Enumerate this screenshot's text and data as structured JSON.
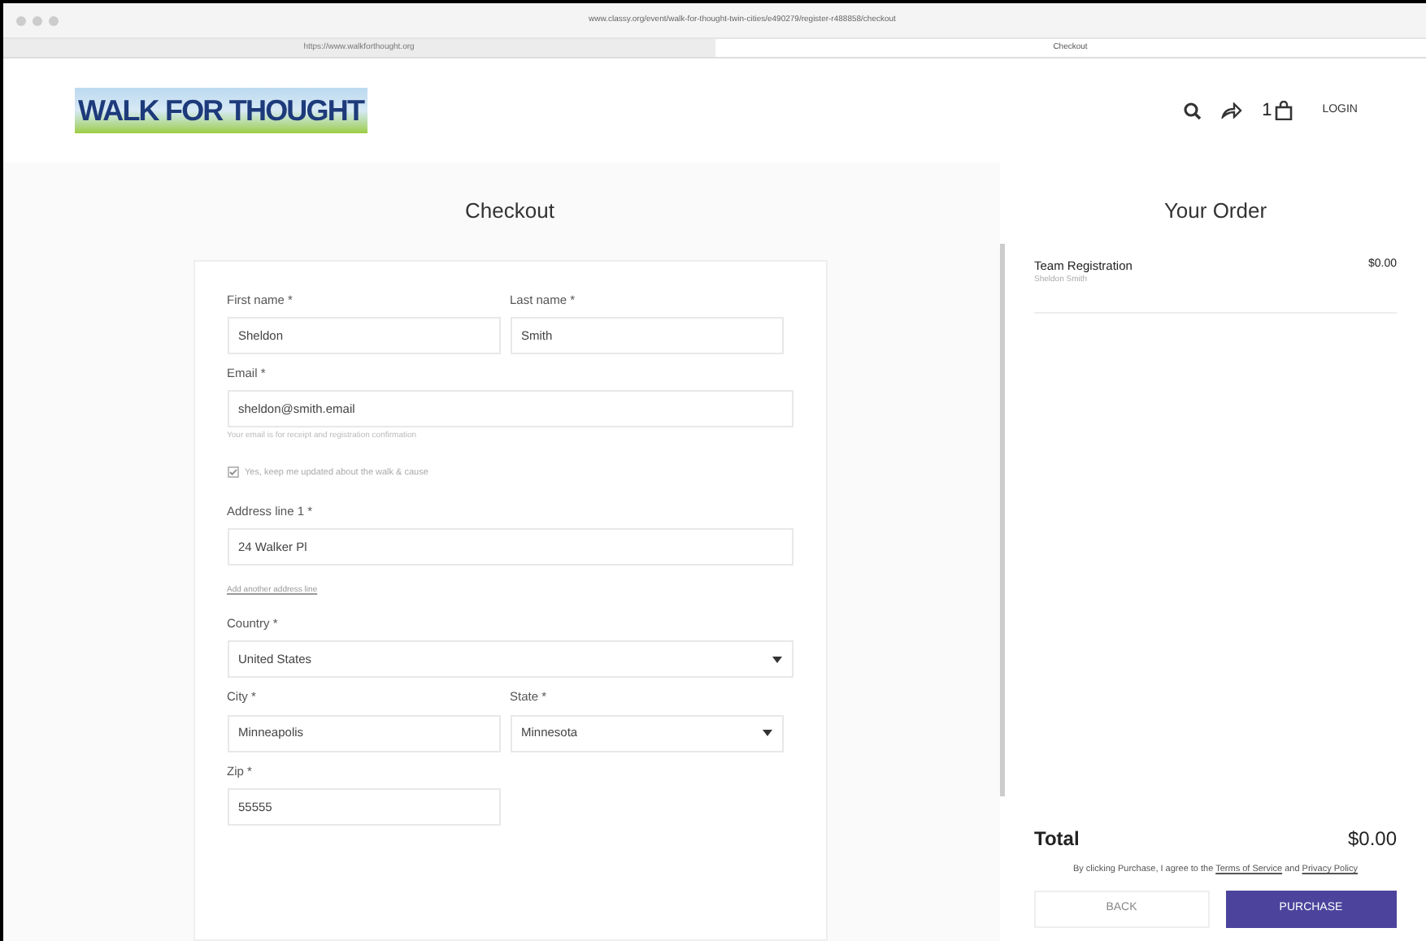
{
  "browser": {
    "url": "www.classy.org/event/walk-for-thought-twin-cities/e490279/register-r488858/checkout",
    "tabs": [
      {
        "title": "https://www.walkforthought.org",
        "selected": false
      },
      {
        "title": "Checkout",
        "selected": true
      }
    ]
  },
  "header": {
    "logo": "WALK FOR THOUGHT",
    "cart_count": "1",
    "login": "LOGIN"
  },
  "checkout": {
    "title": "Checkout",
    "fields": [
      {
        "kind": "input",
        "label": "First name *",
        "value": "Sheldon",
        "half": true
      },
      {
        "kind": "input",
        "label": "Last name *",
        "value": "Smith",
        "half": true
      },
      {
        "kind": "input",
        "label": "Email *",
        "value": "sheldon@smith.email",
        "hint": "Your email is for receipt and registration confirmation"
      },
      {
        "kind": "checkbox",
        "label": "Yes, keep me updated about the walk & cause",
        "checked": true
      },
      {
        "kind": "input",
        "label": "Address line 1 *",
        "value": "24 Walker Pl",
        "link": "Add another address line"
      },
      {
        "kind": "select",
        "label": "Country *",
        "value": "United States"
      },
      {
        "kind": "input",
        "label": "City *",
        "value": "Minneapolis",
        "half": true
      },
      {
        "kind": "select",
        "label": "State *",
        "value": "Minnesota",
        "half": true
      },
      {
        "kind": "input",
        "label": "Zip *",
        "value": "55555",
        "half": true
      }
    ]
  },
  "order": {
    "title": "Your Order",
    "items": [
      {
        "name": "Team Registration",
        "detail": "Sheldon Smith",
        "price": "$0.00"
      }
    ],
    "total_label": "Total",
    "total": "$0.00",
    "agreement": [
      "By clicking Purchase, I agree to the ",
      "Terms of Service",
      " and ",
      "Privacy Policy"
    ],
    "buttons": [
      {
        "kind": "secondary",
        "label": "BACK"
      },
      {
        "kind": "primary",
        "label": "PURCHASE"
      }
    ]
  }
}
